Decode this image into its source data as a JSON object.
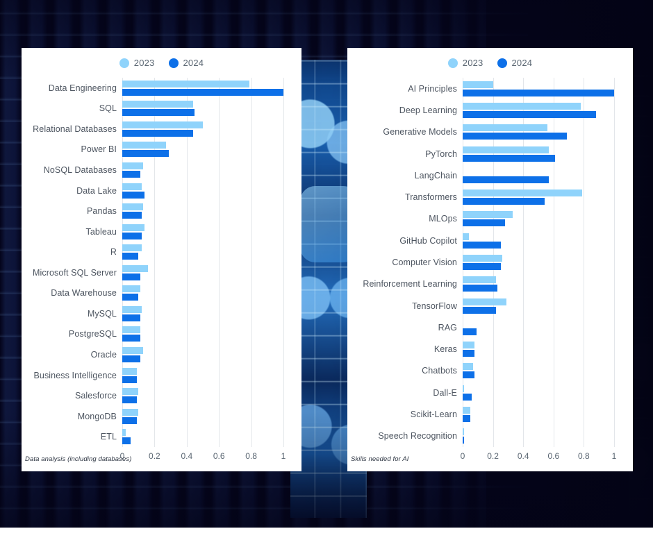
{
  "legend": {
    "items": [
      {
        "label": "2023",
        "color": "#8fd3fb",
        "icon": "circle-legend-icon"
      },
      {
        "label": "2024",
        "color": "#0d70e8",
        "icon": "circle-legend-icon"
      }
    ]
  },
  "axis": {
    "ticks": [
      "0",
      "0.2",
      "0.4",
      "0.6",
      "0.8",
      "1"
    ],
    "values": [
      0,
      0.2,
      0.4,
      0.6,
      0.8,
      1.0
    ],
    "min": 0,
    "max": 1.0
  },
  "charts": [
    {
      "id": "data-analysis",
      "footnote": "Data analysis (including databases)"
    },
    {
      "id": "ai-skills",
      "footnote": "Skills needed for AI"
    }
  ],
  "chart_data": [
    {
      "type": "bar",
      "orientation": "horizontal",
      "title": "",
      "subtitle": "",
      "annotation": "Data analysis (including databases)",
      "xlabel": "",
      "ylabel": "",
      "xlim": [
        0,
        1.0
      ],
      "grid": true,
      "legend_position": "top-center",
      "categories": [
        "Data Engineering",
        "SQL",
        "Relational Databases",
        "Power BI",
        "NoSQL Databases",
        "Data Lake",
        "Pandas",
        "Tableau",
        "R",
        "Microsoft SQL Server",
        "Data Warehouse",
        "MySQL",
        "PostgreSQL",
        "Oracle",
        "Business Intelligence",
        "Salesforce",
        "MongoDB",
        "ETL"
      ],
      "series": [
        {
          "name": "2023",
          "color": "#8fd3fb",
          "values": [
            0.79,
            0.44,
            0.5,
            0.27,
            0.13,
            0.12,
            0.13,
            0.14,
            0.12,
            0.16,
            0.11,
            0.12,
            0.11,
            0.13,
            0.09,
            0.1,
            0.1,
            0.02
          ]
        },
        {
          "name": "2024",
          "color": "#0d70e8",
          "values": [
            1.0,
            0.45,
            0.44,
            0.29,
            0.11,
            0.14,
            0.12,
            0.12,
            0.1,
            0.11,
            0.1,
            0.11,
            0.11,
            0.11,
            0.09,
            0.09,
            0.09,
            0.05
          ]
        }
      ]
    },
    {
      "type": "bar",
      "orientation": "horizontal",
      "title": "",
      "subtitle": "",
      "annotation": "Skills needed for AI",
      "xlabel": "",
      "ylabel": "",
      "xlim": [
        0,
        1.0
      ],
      "grid": true,
      "legend_position": "top-center",
      "categories": [
        "AI Principles",
        "Deep Learning",
        "Generative Models",
        "PyTorch",
        "LangChain",
        "Transformers",
        "MLOps",
        "GitHub Copilot",
        "Computer Vision",
        "Reinforcement Learning",
        "TensorFlow",
        "RAG",
        "Keras",
        "Chatbots",
        "Dall-E",
        "Scikit-Learn",
        "Speech Recognition"
      ],
      "series": [
        {
          "name": "2023",
          "color": "#8fd3fb",
          "values": [
            0.2,
            0.78,
            0.56,
            0.57,
            0.0,
            0.79,
            0.33,
            0.04,
            0.26,
            0.22,
            0.29,
            0.0,
            0.08,
            0.07,
            0.01,
            0.05,
            0.01
          ]
        },
        {
          "name": "2024",
          "color": "#0d70e8",
          "values": [
            1.0,
            0.88,
            0.69,
            0.61,
            0.57,
            0.54,
            0.28,
            0.25,
            0.25,
            0.23,
            0.22,
            0.09,
            0.08,
            0.08,
            0.06,
            0.05,
            0.01
          ]
        }
      ]
    }
  ]
}
